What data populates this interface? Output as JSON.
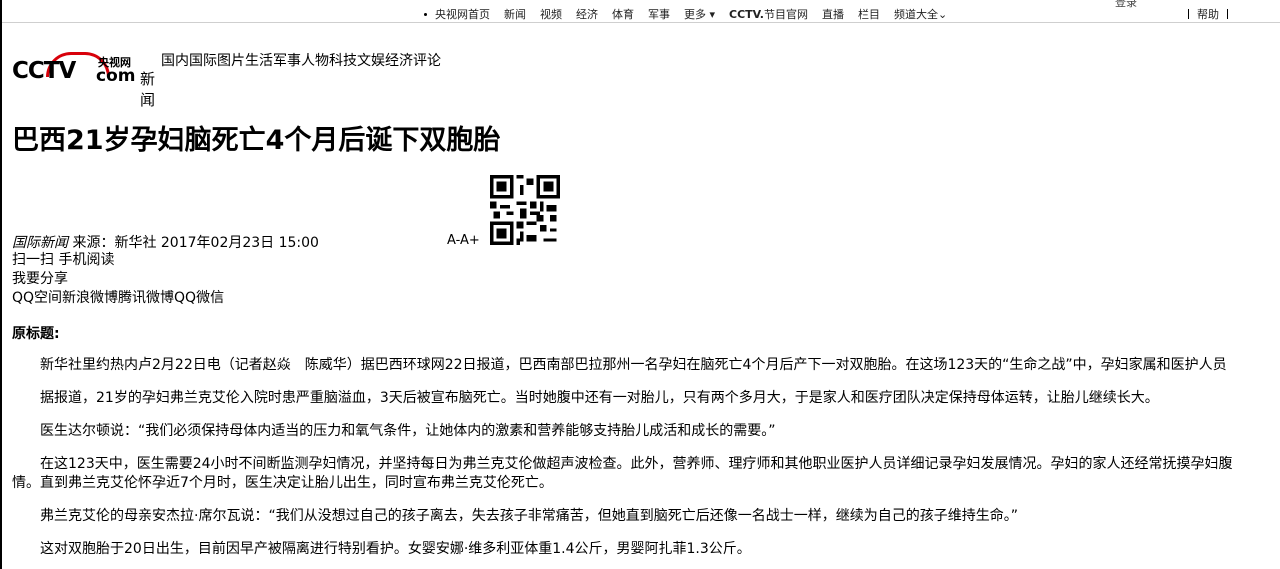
{
  "topbar": {
    "login": "登录",
    "nav": [
      "央视网首页",
      "新闻",
      "视频",
      "经济",
      "体育",
      "军事"
    ],
    "more": "更多",
    "cctv_brand": "CCTV.",
    "cctv_brand_suffix": "节目官网",
    "nav2": [
      "直播",
      "栏目",
      "频道大全"
    ],
    "help": "帮助"
  },
  "logo": {
    "cctv": "CCTV",
    "yang": "央视网",
    "com": "com",
    "xinwen": "新闻"
  },
  "catnav": "国内国际图片生活军事人物科技文娱经济评论",
  "article_title": "巴西21岁孕妇脑死亡4个月后诞下双胞胎",
  "meta": {
    "section": "国际新闻",
    "source": "来源：新华社 2017年02月23日 15:00"
  },
  "font_controls": "A-A+",
  "mobile_read": "扫一扫 手机阅读",
  "share_label": "我要分享",
  "share_links": "QQ空间新浪微博腾讯微博QQ微信",
  "orig_title": "原标题:",
  "paragraphs": [
    "新华社里约热内卢2月22日电（记者赵焱　陈威华）据巴西环球网22日报道，巴西南部巴拉那州一名孕妇在脑死亡4个月后产下一对双胞胎。在这场123天的“生命之战”中，孕妇家属和医护人员",
    "据报道，21岁的孕妇弗兰克艾伦入院时患严重脑溢血，3天后被宣布脑死亡。当时她腹中还有一对胎儿，只有两个多月大，于是家人和医疗团队决定保持母体运转，让胎儿继续长大。",
    "医生达尔顿说：“我们必须保持母体内适当的压力和氧气条件，让她体内的激素和营养能够支持胎儿成活和成长的需要。”",
    "在这123天中，医生需要24小时不间断监测孕妇情况，并坚持每日为弗兰克艾伦做超声波检查。此外，营养师、理疗师和其他职业医护人员详细记录孕妇发展情况。孕妇的家人还经常抚摸孕妇腹",
    "情。直到弗兰克艾伦怀孕近7个月时，医生决定让胎儿出生，同时宣布弗兰克艾伦死亡。",
    "弗兰克艾伦的母亲安杰拉·席尔瓦说：“我们从没想过自己的孩子离去，失去孩子非常痛苦，但她直到脑死亡后还像一名战士一样，继续为自己的孩子维持生命。”",
    "这对双胞胎于20日出生，目前因早产被隔离进行特别看护。女婴安娜·维多利亚体重1.4公斤，男婴阿扎菲1.3公斤。"
  ],
  "colors": {
    "brand_red": "#d8000a"
  }
}
